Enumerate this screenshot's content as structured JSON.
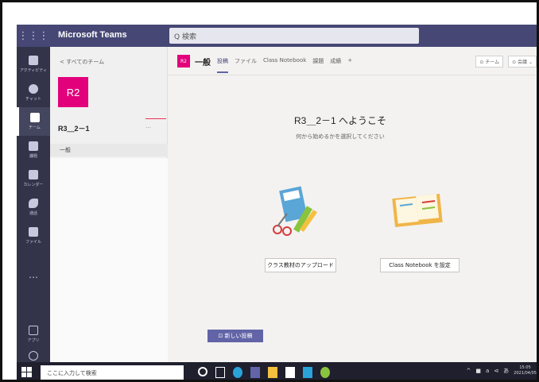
{
  "app": {
    "title": "Microsoft Teams",
    "search_placeholder": "Q 検索"
  },
  "rail": {
    "items": [
      {
        "label": "アクティビティ"
      },
      {
        "label": "チャット"
      },
      {
        "label": "チーム"
      },
      {
        "label": "課題"
      },
      {
        "label": "カレンダー"
      },
      {
        "label": "通話"
      },
      {
        "label": "ファイル"
      }
    ],
    "more": "…",
    "apps_label": "アプリ",
    "help_label": "ヘルプ"
  },
  "panel": {
    "back_label": "< すべてのチーム",
    "team_initials": "R2",
    "team_name": "R3＿2－1",
    "team_more": "…",
    "channel": "一般"
  },
  "header": {
    "badge": "R2",
    "channel_title": "一般",
    "tabs": [
      "投稿",
      "ファイル",
      "Class Notebook",
      "課題",
      "成績",
      "+"
    ],
    "right": [
      "⊙ チーム",
      "⊙ 会議 ⌄"
    ]
  },
  "main": {
    "welcome": "R3＿2－1 へようこそ",
    "subtitle": "何から始めるかを選択してください",
    "upload_button": "クラス教材のアップロード",
    "notebook_button": "Class Notebook を設定",
    "new_post_button": "⊡ 新しい投稿"
  },
  "taskbar": {
    "search_placeholder": "ここに入力して検索",
    "time": "15:05",
    "date": "2021/04/05",
    "tray": [
      "^",
      "■",
      "a",
      "⊲",
      "あ"
    ]
  },
  "colors": {
    "accent": "#6264a7",
    "topbar": "#464775",
    "rail": "#33344a",
    "team": "#e3007b"
  }
}
